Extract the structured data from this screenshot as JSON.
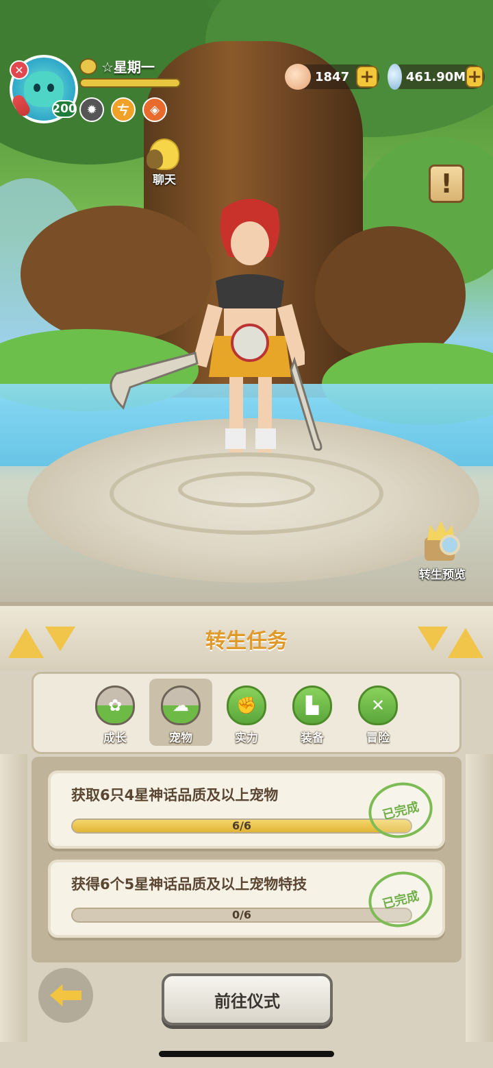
{
  "player": {
    "name": "☆星期一",
    "level": "200",
    "xp_fraction": 1.0
  },
  "currencies": [
    {
      "name": "shells",
      "value": "1847"
    },
    {
      "name": "gems",
      "value": "461.90M"
    }
  ],
  "chat": {
    "label": "聊天"
  },
  "rebirth_preview": {
    "label": "转生预览"
  },
  "panel": {
    "title": "转生任务"
  },
  "tabs": [
    {
      "label": "成长",
      "active": false
    },
    {
      "label": "宠物",
      "active": true
    },
    {
      "label": "实力",
      "active": false
    },
    {
      "label": "装备",
      "active": false
    },
    {
      "label": "冒险",
      "active": false
    }
  ],
  "tasks": [
    {
      "title": "获取6只4星神话品质及以上宠物",
      "progress": "6/6",
      "fraction": 1.0,
      "stamp": "已完成"
    },
    {
      "title": "获得6个5星神话品质及以上宠物特技",
      "progress": "0/6",
      "fraction": 0.0,
      "stamp": "已完成"
    }
  ],
  "buttons": {
    "go": "前往仪式"
  },
  "colors": {
    "title": "#e09a2a",
    "progress": "#e1b536",
    "stamp": "#6fae47"
  }
}
